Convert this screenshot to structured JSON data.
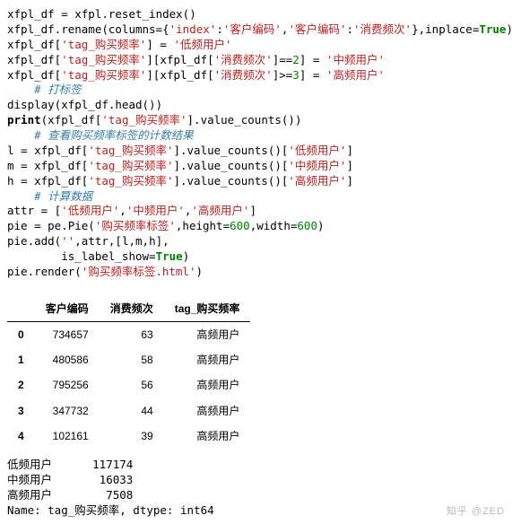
{
  "code": {
    "l01a": "xfpl_df = xfpl.reset_index()",
    "l02a": "xfpl_df.rename(columns={",
    "l02s1": "'index'",
    "l02p1": ":",
    "l02s2": "'客户编码'",
    "l02p2": ",",
    "l02s3": "'客户编码'",
    "l02p3": ":",
    "l02s4": "'消费频次'",
    "l02p4": "},inplace=",
    "l02kw": "True",
    "l02p5": ")",
    "l03a": "xfpl_df[",
    "l03s1": "'tag_购买频率'",
    "l03b": "] = ",
    "l03s2": "'低频用户'",
    "l04a": "xfpl_df[",
    "l04s1": "'tag_购买频率'",
    "l04b": "][xfpl_df[",
    "l04s2": "'消费频次'",
    "l04c": "]==",
    "l04n": "2",
    "l04d": "] = ",
    "l04s3": "'中频用户'",
    "l05a": "xfpl_df[",
    "l05s1": "'tag_购买频率'",
    "l05b": "][xfpl_df[",
    "l05s2": "'消费频次'",
    "l05c": "]>=",
    "l05n": "3",
    "l05d": "] = ",
    "l05s3": "'高频用户'",
    "c1": "    # 打标签",
    "l06": "display(xfpl_df.head())",
    "l07a": "print",
    "l07b": "(xfpl_df[",
    "l07s": "'tag_购买频率'",
    "l07c": "].value_counts())",
    "c2": "    # 查看购买频率标签的计数结果",
    "l08a": "l = xfpl_df[",
    "l08s1": "'tag_购买频率'",
    "l08b": "].value_counts()[",
    "l08s2": "'低频用户'",
    "l08c": "]",
    "l09a": "m = xfpl_df[",
    "l09s1": "'tag_购买频率'",
    "l09b": "].value_counts()[",
    "l09s2": "'中频用户'",
    "l09c": "]",
    "l10a": "h = xfpl_df[",
    "l10s1": "'tag_购买频率'",
    "l10b": "].value_counts()[",
    "l10s2": "'高频用户'",
    "l10c": "]",
    "c3": "    # 计算数据",
    "l11a": "attr = [",
    "l11s1": "'低频用户'",
    "l11p1": ",",
    "l11s2": "'中频用户'",
    "l11p2": ",",
    "l11s3": "'高频用户'",
    "l11p3": "]",
    "l12a": "pie = pe.Pie(",
    "l12s": "'购买频率标签'",
    "l12b": ",height=",
    "l12n1": "600",
    "l12c": ",width=",
    "l12n2": "600",
    "l12d": ")",
    "l13a": "pie.add(",
    "l13s": "''",
    "l13b": ",attr,[l,m,h],",
    "l14a": "        is_label_show=",
    "l14kw": "True",
    "l14b": ")",
    "l15a": "pie.render(",
    "l15s": "'购买频率标签.html'",
    "l15b": ")"
  },
  "table": {
    "headers": [
      "客户编码",
      "消费频次",
      "tag_购买频率"
    ],
    "rows": [
      {
        "idx": "0",
        "a": "734657",
        "b": "63",
        "c": "高频用户"
      },
      {
        "idx": "1",
        "a": "480586",
        "b": "58",
        "c": "高频用户"
      },
      {
        "idx": "2",
        "a": "795256",
        "b": "56",
        "c": "高频用户"
      },
      {
        "idx": "3",
        "a": "347732",
        "b": "44",
        "c": "高频用户"
      },
      {
        "idx": "4",
        "a": "102161",
        "b": "39",
        "c": "高频用户"
      }
    ]
  },
  "output": {
    "r1a": "低频用户      ",
    "r1b": "117174",
    "r2a": "中频用户       ",
    "r2b": "16033",
    "r3a": "高频用户        ",
    "r3b": "7508",
    "r4": "Name: tag_购买频率, dtype: int64"
  },
  "watermark": "知乎 @ZED",
  "chart_data": {
    "type": "table",
    "headers": [
      "客户编码",
      "消费频次",
      "tag_购买频率"
    ],
    "rows": [
      [
        "734657",
        63,
        "高频用户"
      ],
      [
        "480586",
        58,
        "高频用户"
      ],
      [
        "795256",
        56,
        "高频用户"
      ],
      [
        "347732",
        44,
        "高频用户"
      ],
      [
        "102161",
        39,
        "高频用户"
      ]
    ],
    "value_counts": {
      "低频用户": 117174,
      "中频用户": 16033,
      "高频用户": 7508
    }
  }
}
